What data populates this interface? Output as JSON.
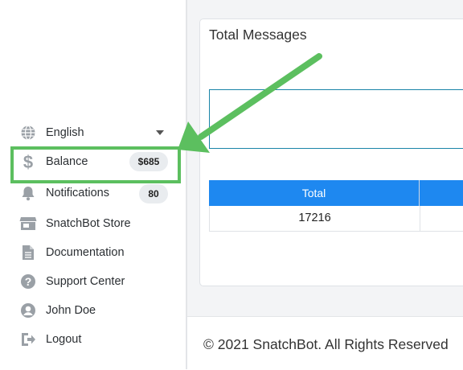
{
  "sidebar": {
    "language": {
      "label": "English",
      "icon": "globe-icon"
    },
    "balance": {
      "label": "Balance",
      "badge": "$685",
      "icon": "dollar-icon"
    },
    "notifications": {
      "label": "Notifications",
      "badge": "80",
      "icon": "bell-icon"
    },
    "store": {
      "label": "SnatchBot Store",
      "icon": "store-icon"
    },
    "documentation": {
      "label": "Documentation",
      "icon": "document-icon"
    },
    "support": {
      "label": "Support Center",
      "icon": "question-icon"
    },
    "user": {
      "label": "John Doe",
      "icon": "user-icon"
    },
    "logout": {
      "label": "Logout",
      "icon": "logout-icon"
    }
  },
  "card": {
    "title": "Total Messages",
    "table": {
      "headers": [
        "Total"
      ],
      "rows": [
        [
          "17216"
        ]
      ]
    }
  },
  "footer": {
    "text": "© 2021 SnatchBot. All Rights Reserved"
  },
  "annotation": {
    "color": "#5cbf5f"
  },
  "colors": {
    "table_header": "#1e88f0",
    "icon": "#9aa0a6"
  }
}
